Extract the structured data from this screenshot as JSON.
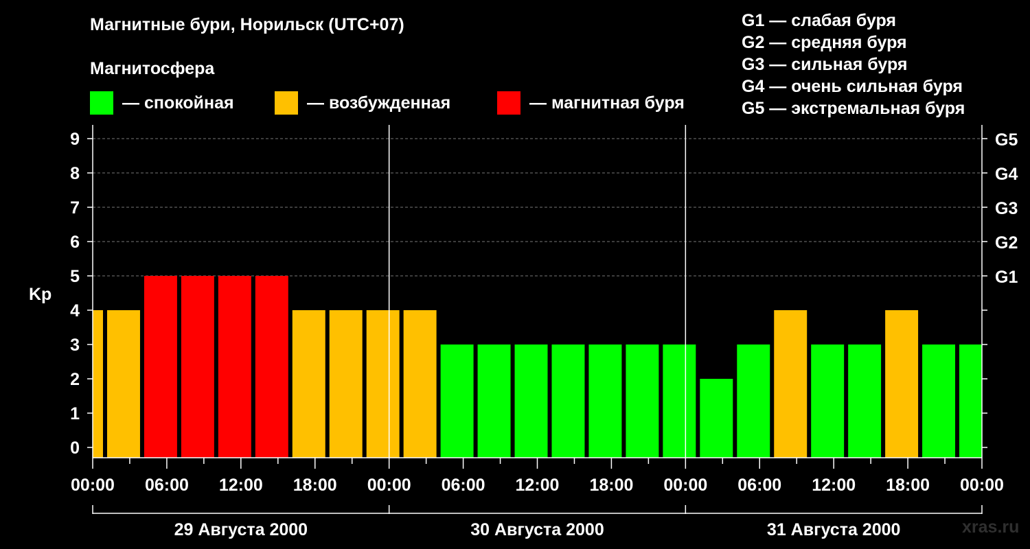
{
  "title": "Магнитные бури, Норильск (UTC+07)",
  "subtitle": "Магнитосфера",
  "legend": [
    {
      "label": "— спокойная",
      "color": "#00ff00"
    },
    {
      "label": "— возбужденная",
      "color": "#ffc000"
    },
    {
      "label": "— магнитная буря",
      "color": "#ff0000"
    }
  ],
  "g_legend": [
    "G1 — слабая буря",
    "G2 — средняя буря",
    "G3 — сильная буря",
    "G4 — очень сильная буря",
    "G5 — экстремальная буря"
  ],
  "watermark": "xras.ru",
  "chart_data": {
    "type": "bar",
    "ylabel": "Kp",
    "ylim": [
      0,
      9
    ],
    "y_ticks": [
      "0",
      "1",
      "2",
      "3",
      "4",
      "5",
      "6",
      "7",
      "8",
      "9"
    ],
    "g_scale_ticks": [
      {
        "kp": 5,
        "label": "G1"
      },
      {
        "kp": 6,
        "label": "G2"
      },
      {
        "kp": 7,
        "label": "G3"
      },
      {
        "kp": 8,
        "label": "G4"
      },
      {
        "kp": 9,
        "label": "G5"
      }
    ],
    "x_tick_labels": [
      "00:00",
      "06:00",
      "12:00",
      "18:00",
      "00:00",
      "06:00",
      "12:00",
      "18:00",
      "00:00",
      "06:00",
      "12:00",
      "18:00",
      "00:00"
    ],
    "days": [
      "29 Августа 2000",
      "30 Августа 2000",
      "31 Августа 2000"
    ],
    "grid": "horizontal dashed",
    "colors": {
      "calm": "#00ff00",
      "disturbed": "#ffc000",
      "storm": "#ff0000"
    },
    "bars": [
      {
        "start_h": 0,
        "end_h": 1,
        "kp": 4
      },
      {
        "start_h": 1,
        "end_h": 4,
        "kp": 4
      },
      {
        "start_h": 4,
        "end_h": 7,
        "kp": 5
      },
      {
        "start_h": 7,
        "end_h": 10,
        "kp": 5
      },
      {
        "start_h": 10,
        "end_h": 13,
        "kp": 5
      },
      {
        "start_h": 13,
        "end_h": 16,
        "kp": 5
      },
      {
        "start_h": 16,
        "end_h": 19,
        "kp": 4
      },
      {
        "start_h": 19,
        "end_h": 22,
        "kp": 4
      },
      {
        "start_h": 22,
        "end_h": 25,
        "kp": 4
      },
      {
        "start_h": 25,
        "end_h": 28,
        "kp": 4
      },
      {
        "start_h": 28,
        "end_h": 31,
        "kp": 3
      },
      {
        "start_h": 31,
        "end_h": 34,
        "kp": 3
      },
      {
        "start_h": 34,
        "end_h": 37,
        "kp": 3
      },
      {
        "start_h": 37,
        "end_h": 40,
        "kp": 3
      },
      {
        "start_h": 40,
        "end_h": 43,
        "kp": 3
      },
      {
        "start_h": 43,
        "end_h": 46,
        "kp": 3
      },
      {
        "start_h": 46,
        "end_h": 49,
        "kp": 3
      },
      {
        "start_h": 49,
        "end_h": 52,
        "kp": 2
      },
      {
        "start_h": 52,
        "end_h": 55,
        "kp": 3
      },
      {
        "start_h": 55,
        "end_h": 58,
        "kp": 4
      },
      {
        "start_h": 58,
        "end_h": 61,
        "kp": 3
      },
      {
        "start_h": 61,
        "end_h": 64,
        "kp": 3
      },
      {
        "start_h": 64,
        "end_h": 67,
        "kp": 4
      },
      {
        "start_h": 67,
        "end_h": 70,
        "kp": 3
      },
      {
        "start_h": 70,
        "end_h": 72,
        "kp": 3
      }
    ]
  }
}
